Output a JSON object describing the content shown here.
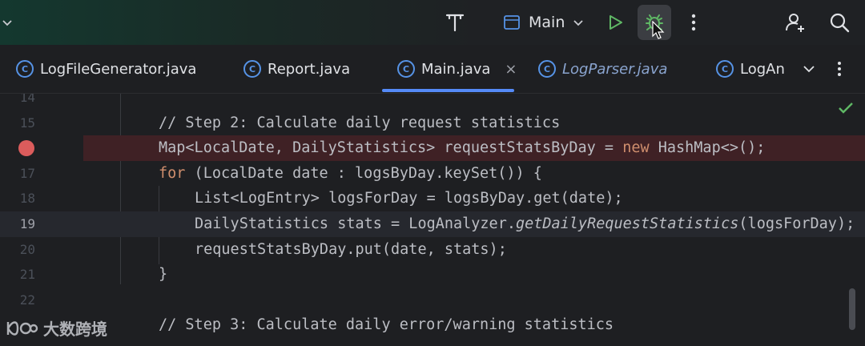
{
  "toolbar": {
    "run_config_label": "Main",
    "icons": [
      "chevron-down-icon",
      "hammer-icon",
      "run-config-icon",
      "run-icon",
      "debug-icon",
      "more-icon",
      "add-user-icon",
      "search-icon"
    ]
  },
  "tabs": [
    {
      "label": "LogFileGenerator.java",
      "active": false,
      "italic": false
    },
    {
      "label": "Report.java",
      "active": false,
      "italic": false
    },
    {
      "label": "Main.java",
      "active": true,
      "italic": false,
      "close": "×"
    },
    {
      "label": "LogParser.java",
      "active": false,
      "italic": true
    },
    {
      "label": "LogAn",
      "active": false,
      "italic": false
    }
  ],
  "tab_class_glyph": "C",
  "editor": {
    "line_numbers": [
      "14",
      "15",
      "16",
      "17",
      "18",
      "19",
      "20",
      "21",
      "22",
      ""
    ],
    "lines": {
      "l15_comment": "// Step 2: Calculate daily request statistics",
      "l16_a": "Map<LocalDate, DailyStatistics> requestStatsByDay = ",
      "l16_kw": "new",
      "l16_b": " HashMap<>();",
      "l17_kw": "for",
      "l17_b": " (LocalDate date : logsByDay.keySet()) {",
      "l18": "List<LogEntry> logsForDay = logsByDay.get(date);",
      "l19_a": "DailyStatistics stats = LogAnalyzer.",
      "l19_it": "getDailyRequestStatistics",
      "l19_b": "(logsForDay);",
      "l20": "requestStatsByDay.put(date, stats);",
      "l21": "}",
      "l23_comment": "// Step 3: Calculate daily error/warning statistics"
    },
    "breakpoint_line": "16",
    "current_line": "19"
  },
  "watermark": "大数跨境",
  "colors": {
    "accent": "#548af7",
    "breakpoint": "#db5c5c",
    "run": "#5fb865",
    "debug": "#5fb865",
    "check": "#5fb865"
  }
}
